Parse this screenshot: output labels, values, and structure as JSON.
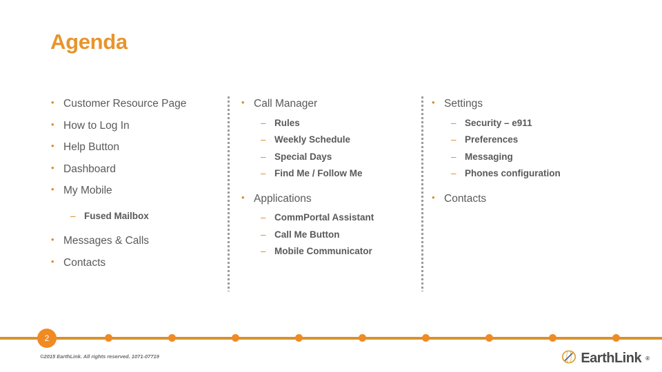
{
  "slide": {
    "title": "Agenda",
    "number": "2"
  },
  "columns": [
    {
      "name": "column-one",
      "items": [
        {
          "level": 1,
          "text": "Customer Resource Page"
        },
        {
          "level": 1,
          "text": "How to Log In"
        },
        {
          "level": 1,
          "text": "Help Button"
        },
        {
          "level": 1,
          "text": "Dashboard"
        },
        {
          "level": 1,
          "text": "My Mobile"
        },
        {
          "level": 2,
          "text": "Fused Mailbox"
        },
        {
          "level": 1,
          "text": "Messages & Calls"
        },
        {
          "level": 1,
          "text": "Contacts"
        }
      ]
    },
    {
      "name": "column-two",
      "items": [
        {
          "level": 1,
          "text": "Call Manager"
        },
        {
          "level": 2,
          "text": "Rules"
        },
        {
          "level": 2,
          "text": "Weekly Schedule"
        },
        {
          "level": 2,
          "text": "Special Days"
        },
        {
          "level": 2,
          "text": "Find Me / Follow Me"
        },
        {
          "level": 1,
          "text": "Applications"
        },
        {
          "level": 2,
          "text": "CommPortal Assistant"
        },
        {
          "level": 2,
          "text": "Call Me Button"
        },
        {
          "level": 2,
          "text": "Mobile Communicator"
        }
      ]
    },
    {
      "name": "column-three",
      "items": [
        {
          "level": 1,
          "text": "Settings"
        },
        {
          "level": 2,
          "text": "Security – e911"
        },
        {
          "level": 2,
          "text": "Preferences"
        },
        {
          "level": 2,
          "text": "Messaging"
        },
        {
          "level": 2,
          "text": "Phones configuration"
        },
        {
          "level": 1,
          "text": "Contacts"
        }
      ]
    }
  ],
  "footer": {
    "copyright": "©2015 EarthLink. All rights reserved. 1071-07719",
    "logo_text": "EarthLink",
    "logo_trademark": "®"
  },
  "colors": {
    "accent_orange": "#E8942C",
    "rule_orange": "#D9912E",
    "dot_orange": "#F08A22",
    "body_text": "#595959",
    "divider_gray": "#9a9a9a"
  }
}
